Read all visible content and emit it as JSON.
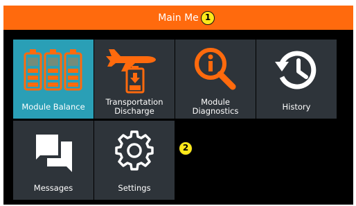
{
  "header": {
    "title": "Main Me"
  },
  "callouts": [
    "1",
    "2"
  ],
  "tiles": [
    {
      "label": "Module Balance",
      "icon": "battery-modules-icon",
      "selected": true
    },
    {
      "label": "Transportation\nDischarge",
      "icon": "airplane-battery-icon"
    },
    {
      "label": "Module\nDiagnostics",
      "icon": "info-magnifier-icon"
    },
    {
      "label": "History",
      "icon": "history-clock-icon"
    },
    {
      "label": "Messages",
      "icon": "chat-bubbles-icon"
    },
    {
      "label": "Settings",
      "icon": "gear-icon"
    }
  ],
  "colors": {
    "accent": "#ff6a0d",
    "tile": "#2e343a",
    "selected": "#2a9fb6",
    "callout": "#ffe81a"
  }
}
